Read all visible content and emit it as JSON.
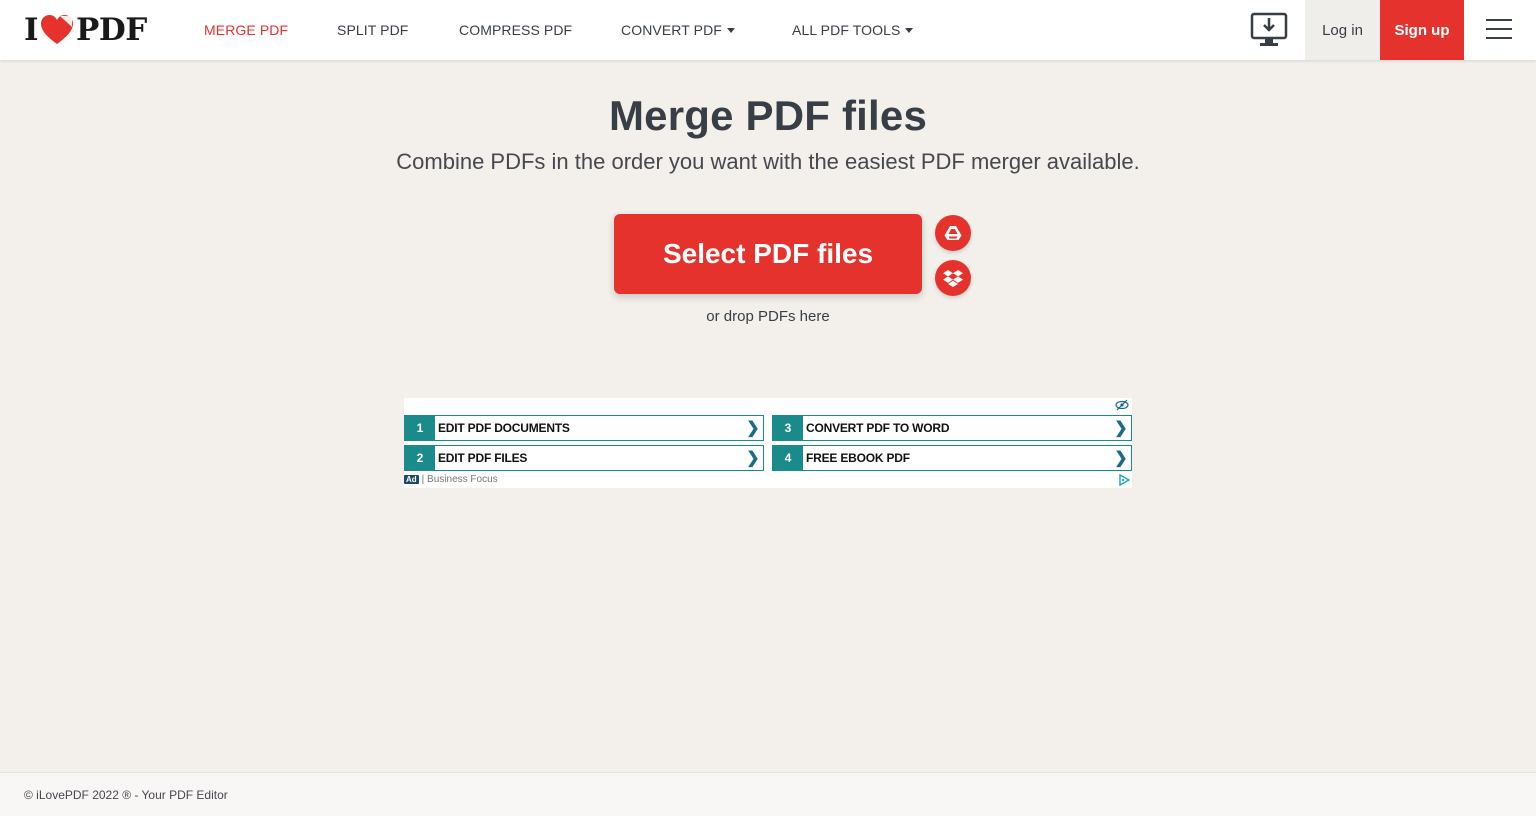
{
  "header": {
    "logo": {
      "left": "I",
      "right": "PDF",
      "icon": "heart-icon"
    },
    "nav": [
      {
        "label": "MERGE PDF",
        "active": true
      },
      {
        "label": "SPLIT PDF"
      },
      {
        "label": "COMPRESS PDF"
      },
      {
        "label": "CONVERT PDF",
        "dropdown": true
      },
      {
        "label": "ALL PDF TOOLS",
        "dropdown": true
      }
    ],
    "desktop_icon": "desktop-download-icon",
    "login": "Log in",
    "signup": "Sign up",
    "menu_icon": "hamburger-menu-icon"
  },
  "main": {
    "title": "Merge PDF files",
    "subtitle": "Combine PDFs in the order you want with the easiest PDF merger available.",
    "select_button": "Select PDF files",
    "drop_text": "or drop PDFs here",
    "cloud_icons": [
      "google-drive-icon",
      "dropbox-icon"
    ]
  },
  "ad": {
    "items": [
      {
        "num": "1",
        "label": "EDIT PDF DOCUMENTS"
      },
      {
        "num": "2",
        "label": "EDIT PDF FILES"
      },
      {
        "num": "3",
        "label": "CONVERT PDF TO WORD"
      },
      {
        "num": "4",
        "label": "FREE EBOOK PDF"
      }
    ],
    "arrow": "❯",
    "badge": "Ad",
    "sponsor": "| Business Focus"
  },
  "footer": {
    "text": "© iLovePDF 2022 ® - Your PDF Editor"
  },
  "colors": {
    "brand_red": "#e5322d",
    "text_dark": "#383e45",
    "background": "#f3f0ec",
    "ad_teal": "#1a8a8a"
  }
}
